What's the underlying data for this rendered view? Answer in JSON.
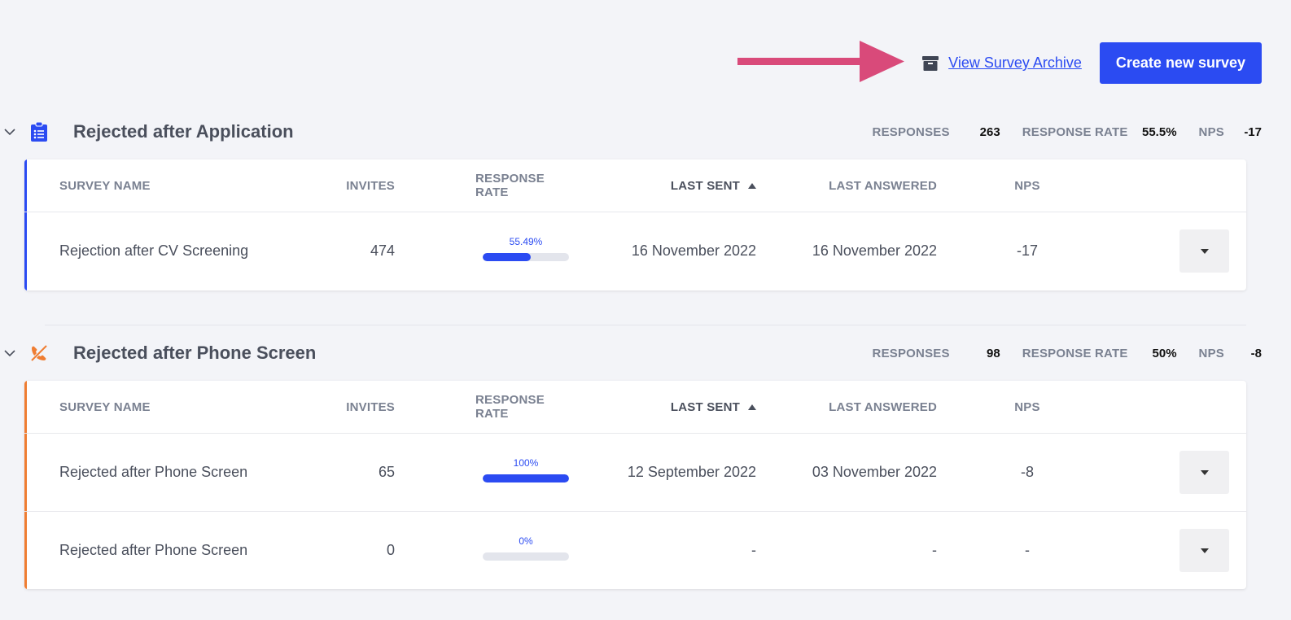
{
  "toolbar": {
    "archive_label": "View Survey Archive",
    "create_label": "Create new survey"
  },
  "columns": {
    "name": "SURVEY NAME",
    "invites": "INVITES",
    "rate": "RESPONSE RATE",
    "last_sent": "LAST SENT",
    "last_answered": "LAST ANSWERED",
    "nps": "NPS"
  },
  "sections": [
    {
      "title": "Rejected after Application",
      "icon": "clipboard-list-icon",
      "accent": "#2b4bf2",
      "stats": {
        "responses_label": "RESPONSES",
        "responses": "263",
        "rate_label": "RESPONSE RATE",
        "rate": "55.5%",
        "nps_label": "NPS",
        "nps": "-17"
      },
      "rows": [
        {
          "name": "Rejection after CV Screening",
          "invites": "474",
          "rate_text": "55.49%",
          "rate_value": 55.49,
          "last_sent": "16 November 2022",
          "last_answered": "16 November 2022",
          "nps": "-17"
        }
      ]
    },
    {
      "title": "Rejected after Phone Screen",
      "icon": "phone-off-icon",
      "accent": "#ef7d32",
      "stats": {
        "responses_label": "RESPONSES",
        "responses": "98",
        "rate_label": "RESPONSE RATE",
        "rate": "50%",
        "nps_label": "NPS",
        "nps": "-8"
      },
      "rows": [
        {
          "name": "Rejected after Phone Screen",
          "invites": "65",
          "rate_text": "100%",
          "rate_value": 100,
          "last_sent": "12 September 2022",
          "last_answered": "03 November 2022",
          "nps": "-8"
        },
        {
          "name": "Rejected after Phone Screen",
          "invites": "0",
          "rate_text": "0%",
          "rate_value": 0,
          "last_sent": "-",
          "last_answered": "-",
          "nps": "-"
        }
      ]
    }
  ],
  "colors": {
    "primary": "#2b4bf2",
    "annotation_arrow": "#d94a7a"
  }
}
